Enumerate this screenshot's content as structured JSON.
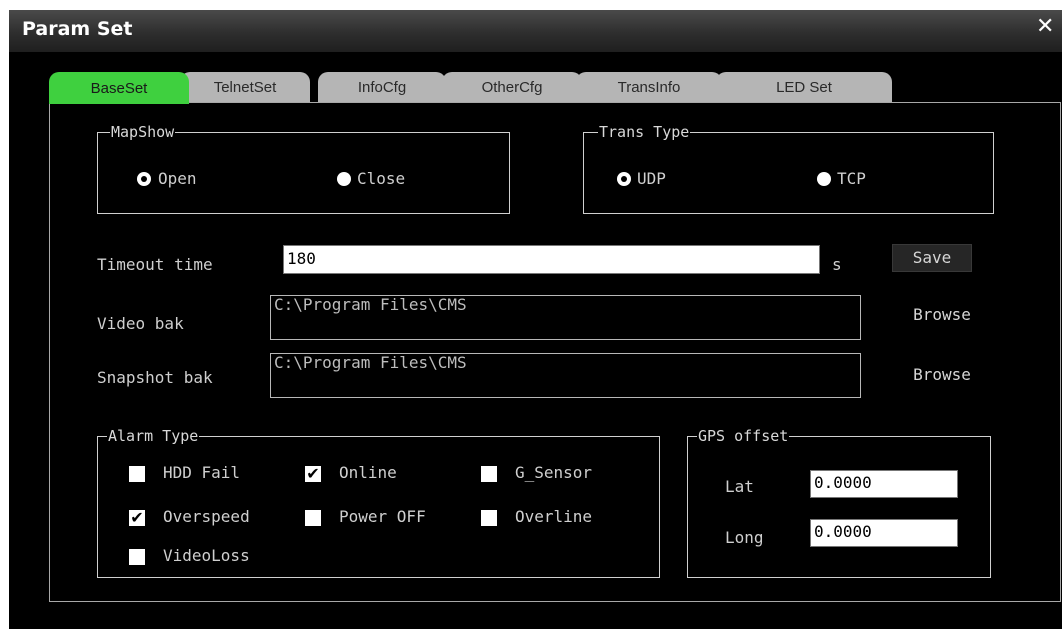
{
  "window": {
    "title": "Param Set",
    "close_glyph": "✕"
  },
  "tabs": [
    "BaseSet",
    "TelnetSet",
    "InfoCfg",
    "OtherCfg",
    "TransInfo",
    "LED Set"
  ],
  "map_show": {
    "legend": "MapShow",
    "open": "Open",
    "close": "Close",
    "selected": "Open"
  },
  "trans_type": {
    "legend": "Trans Type",
    "udp": "UDP",
    "tcp": "TCP",
    "selected": "UDP"
  },
  "timeout": {
    "label": "Timeout time",
    "value": "180",
    "unit": "s",
    "save": "Save"
  },
  "video_bak": {
    "label": "Video bak",
    "value": "C:\\Program Files\\CMS",
    "browse": "Browse"
  },
  "snapshot_bak": {
    "label": "Snapshot bak",
    "value": "C:\\Program Files\\CMS",
    "browse": "Browse"
  },
  "alarm_type": {
    "legend": "Alarm Type",
    "hdd_fail": {
      "label": "HDD Fail",
      "checked": false
    },
    "online": {
      "label": "Online",
      "checked": true
    },
    "g_sensor": {
      "label": "G_Sensor",
      "checked": false
    },
    "overspeed": {
      "label": "Overspeed",
      "checked": true
    },
    "power_off": {
      "label": "Power OFF",
      "checked": false
    },
    "overline": {
      "label": "Overline",
      "checked": false
    },
    "videoloss": {
      "label": "VideoLoss",
      "checked": false
    }
  },
  "gps_offset": {
    "legend": "GPS offset",
    "lat_label": "Lat",
    "lat_value": "0.0000",
    "long_label": "Long",
    "long_value": "0.0000"
  },
  "colors": {
    "active_tab": "#3fd03f",
    "inactive_tab": "#b5b5b5",
    "background": "#000000"
  }
}
